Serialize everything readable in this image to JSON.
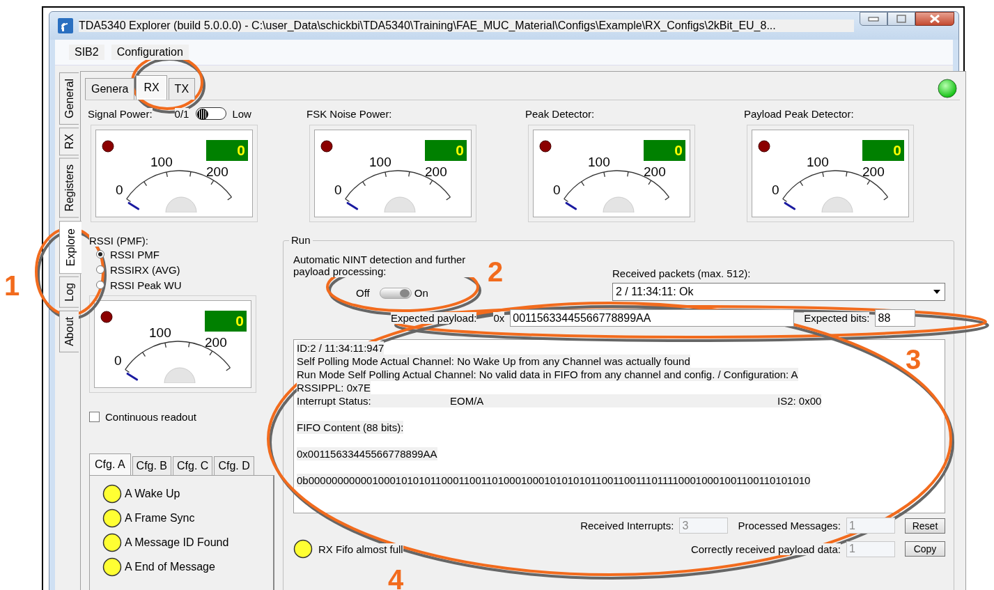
{
  "window": {
    "title": "TDA5340  Explorer (build 5.0.0.0) - C:\\user_Data\\schickbi\\TDA5340\\Training\\FAE_MUC_Material\\Configs\\Example\\RX_Configs\\2kBit_EU_8..."
  },
  "menu": [
    "SIB2",
    "Configuration"
  ],
  "side_tabs": [
    {
      "label": "General",
      "selected": false
    },
    {
      "label": "RX",
      "selected": false
    },
    {
      "label": "Registers",
      "selected": false
    },
    {
      "label": "Explore",
      "selected": true
    },
    {
      "label": "Log",
      "selected": false
    },
    {
      "label": "About",
      "selected": false
    }
  ],
  "tabs": [
    {
      "label": "Genera",
      "selected": false
    },
    {
      "label": "RX",
      "selected": true
    },
    {
      "label": "TX",
      "selected": false
    }
  ],
  "signal_power_switch": {
    "label": "0/1",
    "on": false,
    "state_label": "Low"
  },
  "gauges": [
    {
      "label": "Signal Power:",
      "reading": "0",
      "scale": [
        "0",
        "100",
        "200"
      ]
    },
    {
      "label": "FSK Noise Power:",
      "reading": "0",
      "scale": [
        "0",
        "100",
        "200"
      ]
    },
    {
      "label": "Peak Detector:",
      "reading": "0",
      "scale": [
        "0",
        "100",
        "200"
      ]
    },
    {
      "label": "Payload Peak Detector:",
      "reading": "0",
      "scale": [
        "0",
        "100",
        "200"
      ]
    }
  ],
  "rssi": {
    "title": "RSSI (PMF):",
    "options": [
      {
        "label": "RSSI PMF",
        "selected": true
      },
      {
        "label": "RSSIRX (AVG)",
        "selected": false
      },
      {
        "label": "RSSI Peak WU",
        "selected": false
      }
    ],
    "gauge": {
      "reading": "0",
      "scale": [
        "0",
        "100",
        "200"
      ]
    }
  },
  "continuous_readout": {
    "label": "Continuous readout",
    "checked": false
  },
  "cfg_tabs": [
    {
      "label": "Cfg. A",
      "selected": true
    },
    {
      "label": "Cfg. B",
      "selected": false
    },
    {
      "label": "Cfg. C",
      "selected": false
    },
    {
      "label": "Cfg. D",
      "selected": false
    }
  ],
  "cfg_indicators": [
    "A Wake Up",
    "A Frame Sync",
    "A Message ID Found",
    "A End of Message"
  ],
  "run": {
    "title": "Run",
    "nint_label": "Automatic NINT detection and further payload processing:",
    "off_label": "Off",
    "on_label": "On",
    "on": true,
    "packets_label": "Received packets (max. 512):",
    "packet_value": "2 / 11:34:11: Ok",
    "expected_payload_label": "Expected payload:",
    "prefix": "0x",
    "expected_payload": "00115633445566778899AA",
    "expected_bits_label": "Expected bits:",
    "expected_bits": "88",
    "log": [
      {
        "kind": "text",
        "text": "ID:2 / 11:34:11:947"
      },
      {
        "kind": "text",
        "text": "Self Polling Mode Actual Channel: No Wake Up from any Channel was actually found"
      },
      {
        "kind": "text",
        "text": "Run Mode Self Polling Actual Channel: No valid data in FIFO from any channel and config. / Configuration: A"
      },
      {
        "kind": "text",
        "text": "RSSIPPL: 0x7E"
      },
      {
        "kind": "columns",
        "cells": [
          "Interrupt Status:",
          "EOM/A",
          "IS2: 0x00"
        ]
      },
      {
        "kind": "gap"
      },
      {
        "kind": "text",
        "text": "FIFO Content (88 bits):"
      },
      {
        "kind": "gap"
      },
      {
        "kind": "text",
        "text": "0x00115633445566778899AA"
      },
      {
        "kind": "gap"
      },
      {
        "kind": "text",
        "text": "0b0000000000010001010101100011001101000100010101010110011001110111100010001001100110101010"
      }
    ],
    "received_interrupts": {
      "label": "Received Interrupts:",
      "value": "3",
      "disabled": true
    },
    "processed_messages": {
      "label": "Processed Messages:",
      "value": "1",
      "disabled": true
    },
    "reset": "Reset",
    "fifo_label": "RX Fifo almost full",
    "correct_payload": {
      "label": "Correctly received payload data:",
      "value": "1",
      "disabled": true
    },
    "copy": "Copy"
  },
  "annotations": [
    "1",
    "2",
    "3",
    "4"
  ]
}
